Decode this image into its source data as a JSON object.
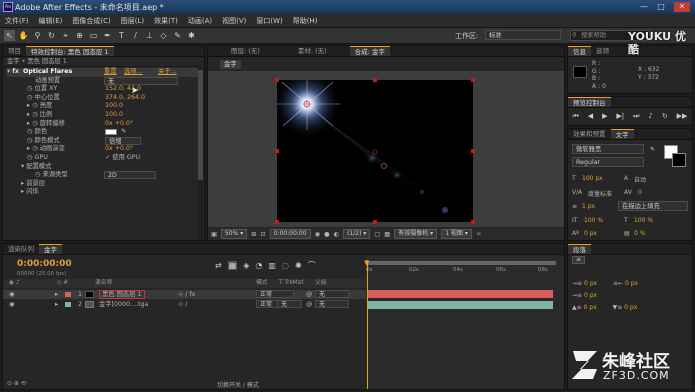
{
  "window": {
    "title": "Adobe After Effects - 未命名项目.aep *",
    "min": "—",
    "max": "□",
    "close": "✕"
  },
  "menu": [
    "文件(F)",
    "编辑(E)",
    "图像合成(C)",
    "图层(L)",
    "效果(T)",
    "动画(A)",
    "视图(V)",
    "窗口(W)",
    "帮助(H)"
  ],
  "workspace": {
    "label": "工作区:",
    "value": "标准",
    "search_placeholder": "搜索帮助"
  },
  "effects_panel": {
    "tabs": [
      "项目",
      "特效控制台: 黑色 固态层 1"
    ],
    "header": "金字 • 黑色 固态层 1",
    "effect_name": "Optical Flares",
    "reset": "重置",
    "options": "选项...",
    "about": "关于...",
    "props": [
      {
        "label": "动画预置",
        "value": "无",
        "kind": "select"
      },
      {
        "label": "位置 XY",
        "value": "152.0, 42.0"
      },
      {
        "label": "中心位置",
        "value": "374.0, 264.0"
      },
      {
        "label": "亮度",
        "value": "100.0"
      },
      {
        "label": "比例",
        "value": "100.0"
      },
      {
        "label": "旋转偏移",
        "value": "0x +0.0°"
      },
      {
        "label": "颜色",
        "value": ""
      },
      {
        "label": "颜色模式",
        "value": "倍增",
        "kind": "select"
      },
      {
        "label": "动画演变",
        "value": "0x +0.0°"
      },
      {
        "label": "GPU",
        "value": "使用 GPU"
      },
      {
        "label": "配置模式",
        "value": ""
      },
      {
        "label": "来源类型",
        "value": "2D",
        "kind": "select"
      },
      {
        "label": "前景层",
        "value": ""
      },
      {
        "label": "闪烁",
        "value": ""
      }
    ]
  },
  "comp_panel": {
    "tabs": [
      "图层: (无)",
      "素材: (无)",
      "合成: 金字"
    ],
    "comp_tab": "金字",
    "zoom": "50%",
    "timecode": "0:00:00:00",
    "resolution": "(1/2)",
    "camera": "有效摄像机",
    "views": "1 视图",
    "offset": "+0.0"
  },
  "info_panel": {
    "tab": "信息",
    "audio_tab": "音频",
    "rgb": [
      "R :",
      "G :",
      "B :",
      "A : 0"
    ],
    "xy": [
      "X : 632",
      "Y : 372"
    ]
  },
  "preview_panel": {
    "tab": "预览控制台"
  },
  "char_panel": {
    "tabs": [
      "效果和预置",
      "文字"
    ],
    "font": "微软雅黑",
    "style": "Regular",
    "size": "100 px",
    "leading": "自动",
    "kerning": "度量标准",
    "tracking": "0",
    "stroke": "1 px",
    "stroke_mode": "在描边上填充",
    "vscale": "100 %",
    "hscale": "100 %",
    "baseline": "0 px",
    "tsume": "0 %"
  },
  "timeline": {
    "tabs": [
      "渲染队列",
      "金字"
    ],
    "timecode": "0:00:00:00",
    "fps": "00000 (25.00 fps)",
    "columns": {
      "name": "源名称",
      "mode": "模式",
      "trk": "T  TrkMat",
      "parent": "父级"
    },
    "ruler": [
      "0s",
      "02s",
      "04s",
      "06s",
      "08s",
      "10s"
    ],
    "layers": [
      {
        "num": "1",
        "name": "黑色 固态层 1",
        "mode": "正常",
        "trk": "",
        "parent": "无",
        "color": "#d95f5f"
      },
      {
        "num": "2",
        "name": "金字[0000....tga",
        "mode": "正常",
        "trk": "无",
        "parent": "无",
        "color": "#7fb3a8"
      }
    ],
    "footer": "切换开关 / 模式"
  },
  "paragraph_panel": {
    "tab": "段落",
    "indent": [
      "0 px",
      "0 px",
      "0 px",
      "0 px",
      "0 px"
    ]
  },
  "watermark": {
    "youku": "YOUKU 优酷",
    "zf3d_name": "朱峰社区",
    "zf3d_url": "ZF3D.COM"
  },
  "colors": {
    "accent": "#f2a21a",
    "layer1": "#d95f5f",
    "layer2": "#7fb3a8",
    "titlebar": "#23476d"
  }
}
